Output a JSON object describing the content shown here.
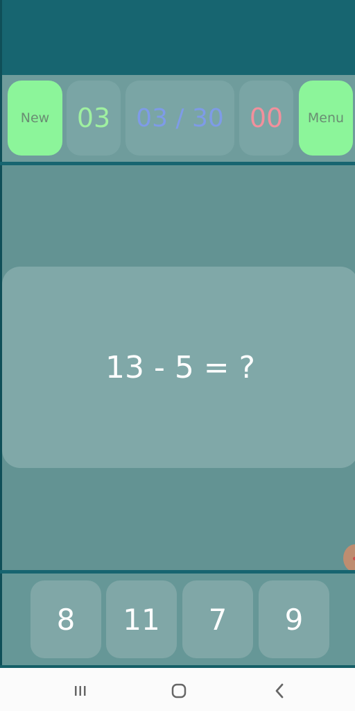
{
  "header": {
    "new_label": "New",
    "counter": "03",
    "progress": "03 / 30",
    "score": "00",
    "menu_label": "Menu"
  },
  "question": {
    "text": "13 - 5 = ?"
  },
  "answers": [
    {
      "label": "8"
    },
    {
      "label": "11"
    },
    {
      "label": "7"
    },
    {
      "label": "9"
    }
  ],
  "navigation": {
    "recent_icon": "recent-apps-icon",
    "home_icon": "home-icon",
    "back_icon": "back-icon"
  },
  "colors": {
    "app_bar": "#176570",
    "accent_green": "#8cf59a",
    "counter_green": "#9ff0a0",
    "progress_blue": "#7e9be8",
    "score_pink": "#f2909c"
  }
}
